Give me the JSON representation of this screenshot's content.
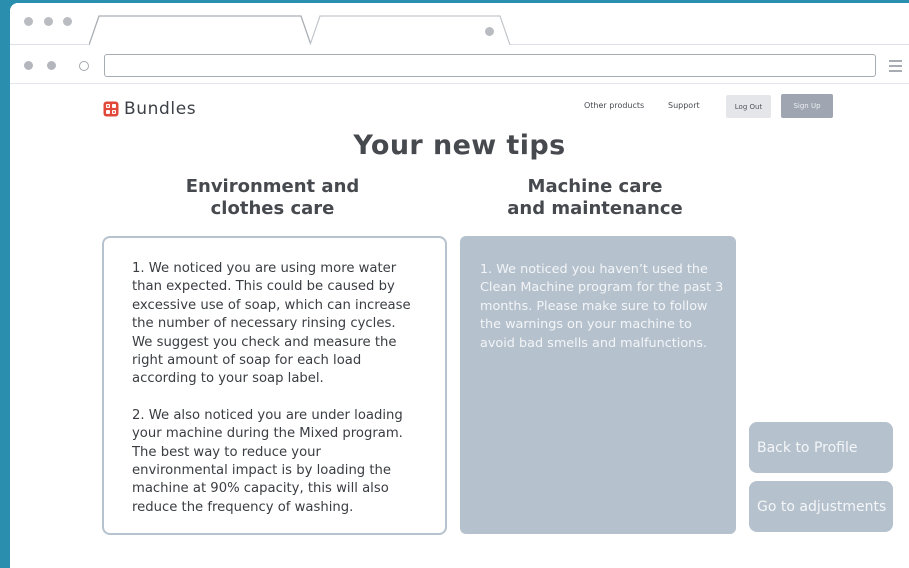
{
  "browser": {
    "tabs": [
      {
        "label": ""
      },
      {
        "label": ""
      }
    ],
    "address": ""
  },
  "header": {
    "brand": "Bundles",
    "nav": [
      "Other products",
      "Support"
    ],
    "logout_label": "Log Out",
    "signup_label": "Sign Up"
  },
  "main": {
    "title": "Your new tips",
    "environment": {
      "title_line1": "Environment and",
      "title_line2": "clothes care",
      "tips": [
        "1. We noticed you are using more water than expected. This could be caused by excessive use of soap, which can increase the number of necessary rinsing cycles. We suggest you check and measure the right amount of soap for each load according to your soap label.",
        "2. We also noticed you are under loading your machine during the Mixed program. The best way to reduce your environmental impact is by loading the machine at 90% capacity, this will also reduce the frequency of washing."
      ]
    },
    "machine": {
      "title_line1": "Machine care",
      "title_line2": "and maintenance",
      "tips": [
        "1. We noticed you haven’t used the Clean Machine program for the past 3 months. Please make sure to follow the warnings on your machine to avoid bad smells and malfunctions."
      ]
    },
    "actions": {
      "back_label": "Back to Profile",
      "adjust_label": "Go to adjustments"
    }
  },
  "colors": {
    "outer_background": "#2a8fae",
    "brand_icon": "#e0493a",
    "card_fill": "#b5c1cd",
    "signup_button": "#9fa5b1"
  },
  "icons": [
    "window-dot-icon",
    "menu-icon",
    "bundles-logo-icon"
  ]
}
